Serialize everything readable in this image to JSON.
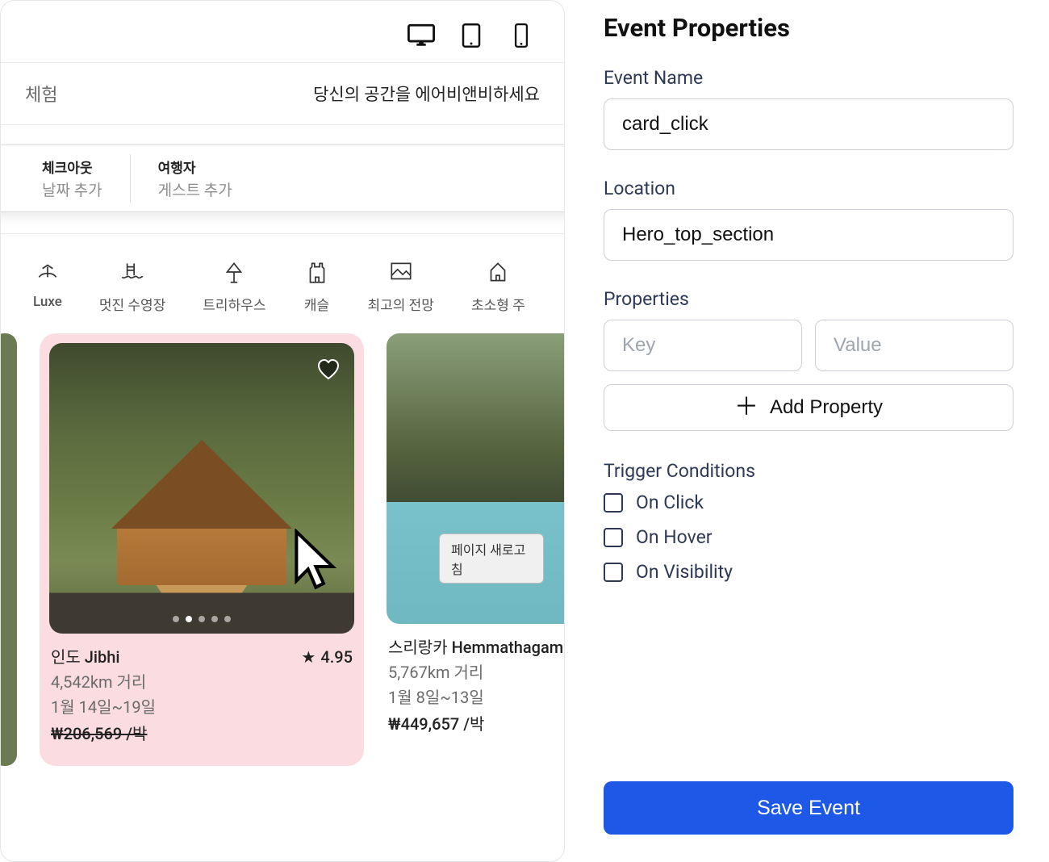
{
  "preview": {
    "header": {
      "left_tab": "체험",
      "right_text": "당신의 공간을 에어비앤비하세요"
    },
    "search": {
      "checkout_label": "체크아웃",
      "checkout_value": "날짜 추가",
      "guests_label": "여행자",
      "guests_value": "게스트 추가"
    },
    "categories": [
      "Luxe",
      "멋진 수영장",
      "트리하우스",
      "캐슬",
      "최고의 전망",
      "초소형 주"
    ],
    "cards": [
      {
        "title": "인도 Jibhi",
        "rating": "4.95",
        "distance": "4,542km 거리",
        "dates": "1월 14일~19일",
        "price": "₩206,569 /박",
        "price_strikethrough": true
      },
      {
        "title": "스리랑카 Hemmathagama,",
        "rating": "",
        "distance": "5,767km 거리",
        "dates": "1월 8일~13일",
        "price": "₩449,657 /박",
        "price_strikethrough": false,
        "reload_label": "페이지 새로고침"
      }
    ]
  },
  "panel": {
    "title": "Event Properties",
    "event_name_label": "Event Name",
    "event_name_value": "card_click",
    "location_label": "Location",
    "location_value": "Hero_top_section",
    "properties_label": "Properties",
    "key_placeholder": "Key",
    "value_placeholder": "Value",
    "add_property_label": "Add Property",
    "trigger_label": "Trigger Conditions",
    "triggers": [
      "On Click",
      "On Hover",
      "On Visibility"
    ],
    "save_label": "Save Event"
  }
}
